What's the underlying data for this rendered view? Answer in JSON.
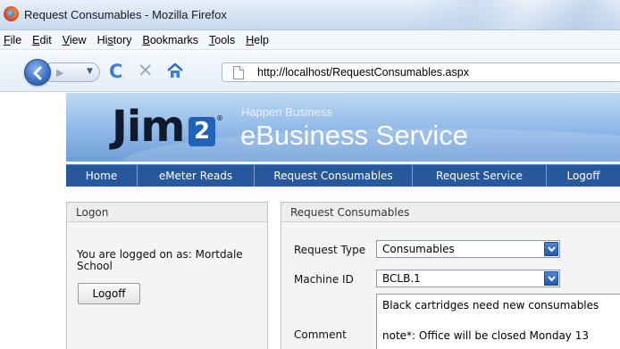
{
  "window": {
    "title": "Request Consumables - Mozilla Firefox"
  },
  "menubar": {
    "items": [
      {
        "accel": "F",
        "rest": "ile"
      },
      {
        "accel": "E",
        "rest": "dit"
      },
      {
        "accel": "V",
        "rest": "iew"
      },
      {
        "pre": "Hi",
        "accel": "s",
        "rest": "tory"
      },
      {
        "accel": "B",
        "rest": "ookmarks"
      },
      {
        "accel": "T",
        "rest": "ools"
      },
      {
        "accel": "H",
        "rest": "elp"
      }
    ]
  },
  "navbar": {
    "url": "http://localhost/RequestConsumables.aspx",
    "icons": [
      "back-arrow-icon",
      "forward-arrow-icon",
      "reload-icon",
      "stop-icon",
      "home-icon",
      "page-icon"
    ]
  },
  "header": {
    "logo_text": "Jim",
    "logo_number": "2",
    "logo_mark": "®",
    "tagline": "Happen Business",
    "service": "eBusiness Service"
  },
  "sitemenu": {
    "items": [
      "Home",
      "eMeter Reads",
      "Request Consumables",
      "Request Service",
      "Logoff"
    ]
  },
  "logon": {
    "title": "Logon",
    "message": "You are logged on as: Mortdale School",
    "button": "Logoff"
  },
  "request": {
    "title": "Request Consumables",
    "type_label": "Request Type",
    "type_value": "Consumables",
    "machine_label": "Machine ID",
    "machine_value": "BCLB.1",
    "comment_label": "Comment",
    "comment_line1": "Black cartridges need new consumables",
    "comment_line2": "note*: Office will be closed Monday 13"
  },
  "colors": {
    "site_menu": "#27589d",
    "header_blue": "#8fb8e7",
    "select_button": "#2f65b8"
  }
}
